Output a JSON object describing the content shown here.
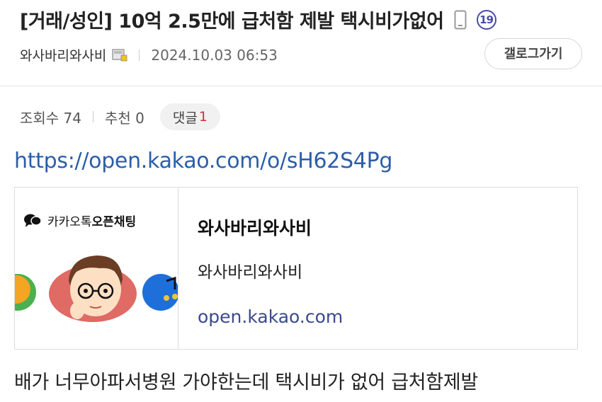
{
  "post": {
    "title": "[거래/성인] 10억 2.5만에 급처함 제발 택시비가없어",
    "adult_badge": "19",
    "author": "와사바리와사비",
    "date": "2024.10.03 06:53",
    "views_label": "조회수 74",
    "likes_label": "추천 0",
    "comment_label": "댓글",
    "comment_count": "1",
    "link_url": "https://open.kakao.com/o/sH62S4Pg",
    "body": "배가 너무아파서병원 가야한는데 택시비가 없어 급처함제발"
  },
  "header": {
    "gallery_button": "갤로그가기"
  },
  "card": {
    "brand_prefix": "카카오톡",
    "brand_suffix": "오픈채팅",
    "title": "와사바리와사비",
    "description": "와사바리와사비",
    "domain": "open.kakao.com"
  },
  "colors": {
    "link": "#2c5ea8",
    "comment_count": "#d32f2f",
    "adult_badge": "#4a4ab0"
  }
}
